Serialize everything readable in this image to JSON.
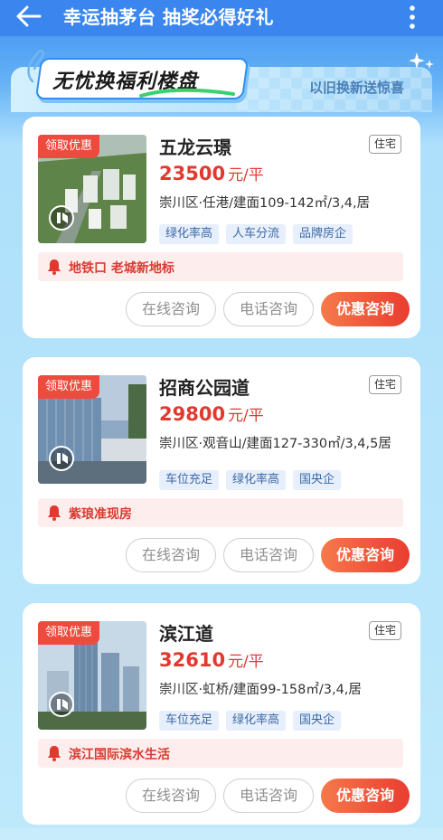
{
  "header": {
    "title": "幸运抽茅台 抽奖必得好礼",
    "back_icon": "back-arrow-icon",
    "more_icon": "more-vertical-icon",
    "background": "#3a86ee"
  },
  "banner": {
    "title": "无忧换福利楼盘",
    "subtitle": "以旧换新送惊喜"
  },
  "listings": [
    {
      "promo_tag": "领取优惠",
      "name": "五龙云璟",
      "type": "住宅",
      "price": "23500",
      "price_unit": "元/平",
      "location": "崇川区·任港/建面109-142㎡/3,4,居",
      "features": [
        "绿化率高",
        "人车分流",
        "品牌房企"
      ],
      "notice": "地铁口 老城新地标",
      "buttons": {
        "online": "在线咨询",
        "phone": "电话咨询",
        "promo": "优惠咨询"
      }
    },
    {
      "promo_tag": "领取优惠",
      "name": "招商公园道",
      "type": "住宅",
      "price": "29800",
      "price_unit": "元/平",
      "location": "崇川区·观音山/建面127-330㎡/3,4,5居",
      "features": [
        "车位充足",
        "绿化率高",
        "国央企"
      ],
      "notice": "紫琅准现房",
      "buttons": {
        "online": "在线咨询",
        "phone": "电话咨询",
        "promo": "优惠咨询"
      }
    },
    {
      "promo_tag": "领取优惠",
      "name": "滨江道",
      "type": "住宅",
      "price": "32610",
      "price_unit": "元/平",
      "location": "崇川区·虹桥/建面99-158㎡/3,4,居",
      "features": [
        "车位充足",
        "绿化率高",
        "国央企"
      ],
      "notice": "滨江国际滨水生活",
      "buttons": {
        "online": "在线咨询",
        "phone": "电话咨询",
        "promo": "优惠咨询"
      }
    }
  ],
  "colors": {
    "accent_red": "#e1392f",
    "brand_blue": "#3a86ee"
  }
}
